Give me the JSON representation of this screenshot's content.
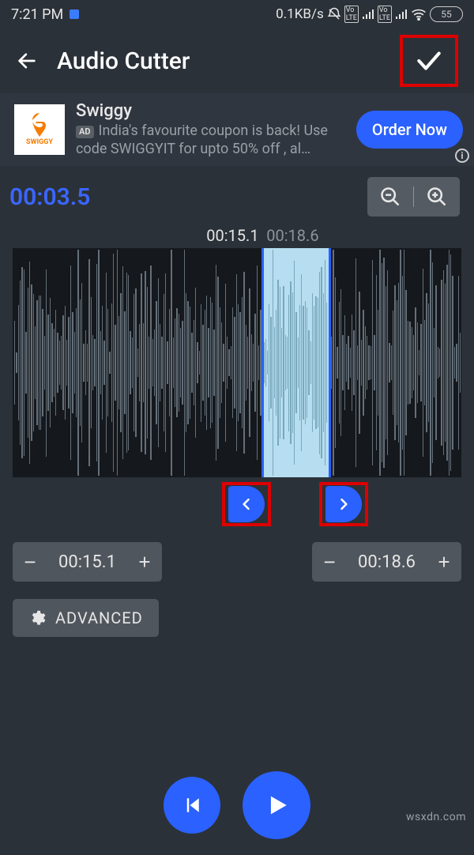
{
  "status": {
    "time": "7:21 PM",
    "net_speed": "0.1KB/s",
    "battery": "55"
  },
  "appbar": {
    "title": "Audio Cutter"
  },
  "ad": {
    "brand_logo_text": "SWIGGY",
    "title": "Swiggy",
    "tag": "AD",
    "desc": "India's favourite coupon is back! Use code SWIGGYIT for upto 50% off , al…",
    "cta": "Order Now"
  },
  "timebar": {
    "duration": "00:03.5",
    "marker_start": "00:15.1",
    "marker_end": "00:18.6"
  },
  "selection": {
    "start_pct": 55.5,
    "end_pct": 70.5
  },
  "steppers": {
    "start": "00:15.1",
    "end": "00:18.6",
    "minus": "−",
    "plus": "+"
  },
  "advanced_label": "ADVANCED",
  "watermark": "wsxdn.com"
}
